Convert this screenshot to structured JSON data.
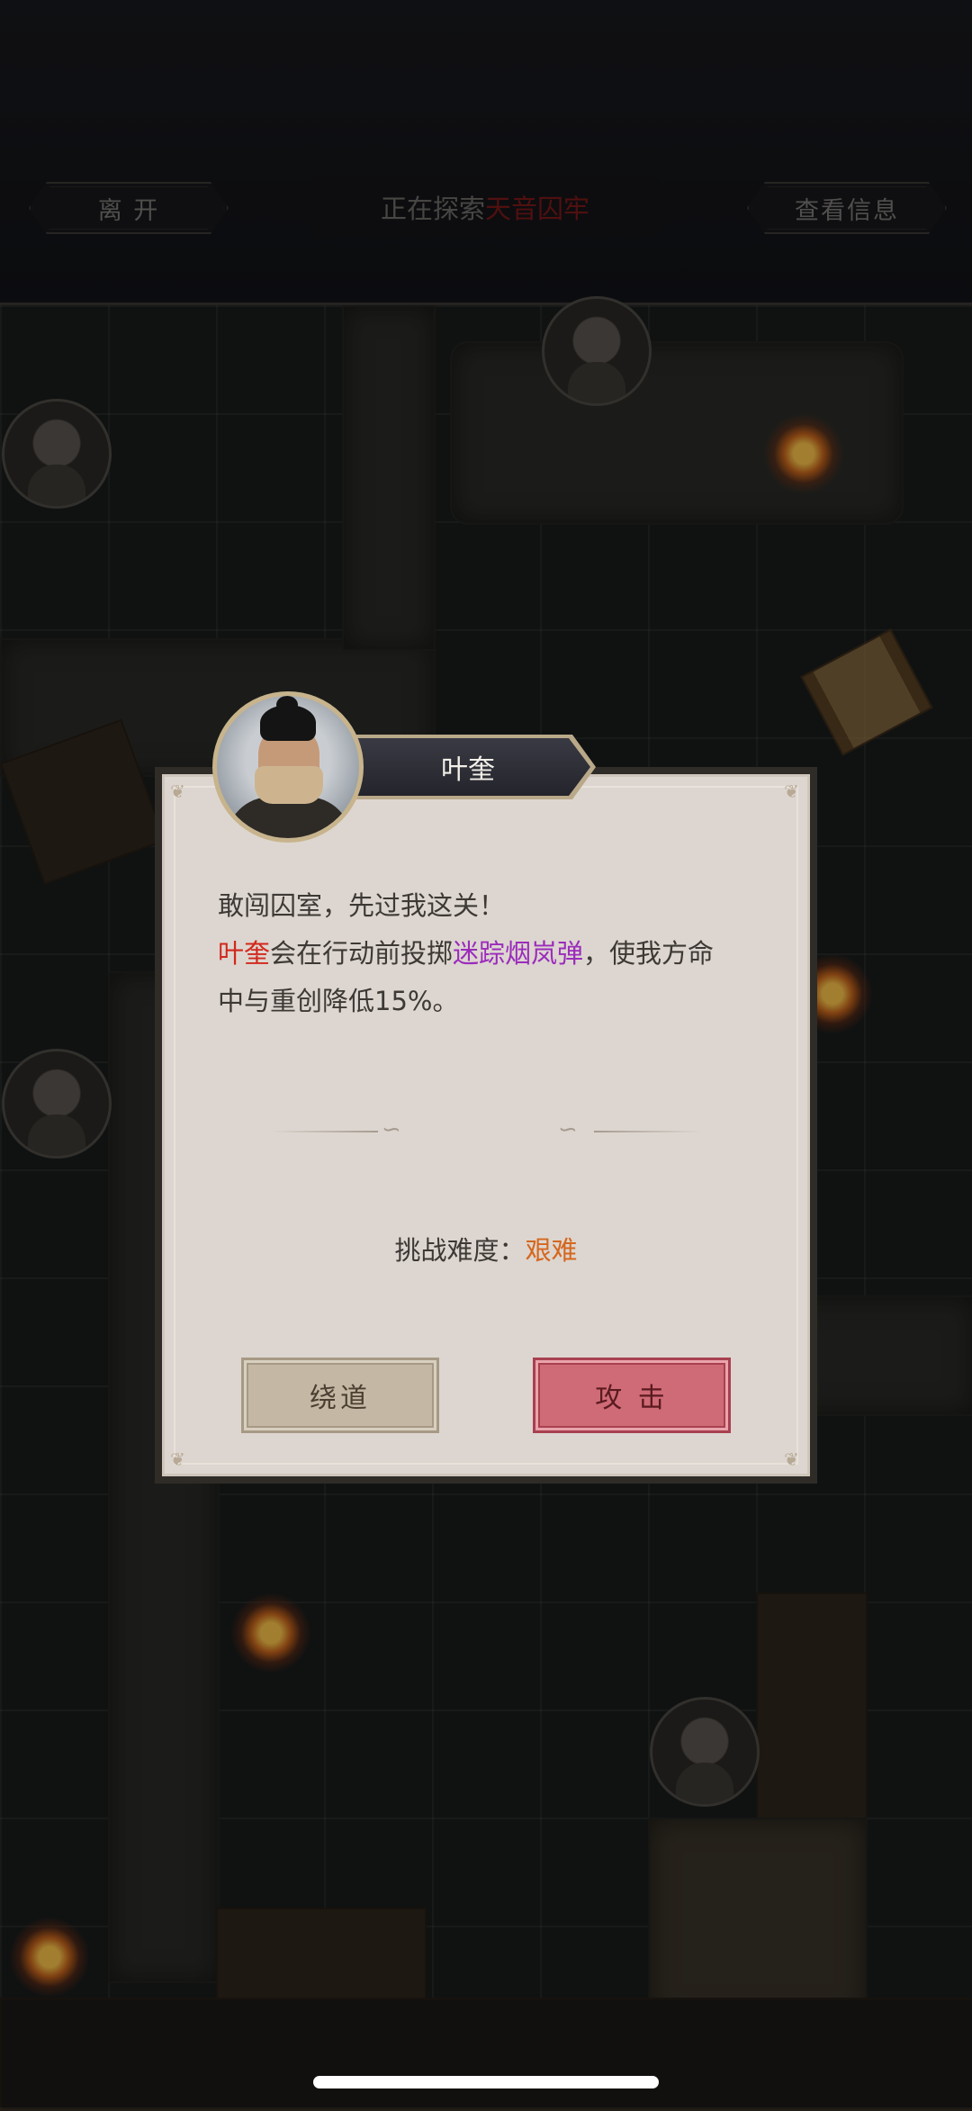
{
  "header": {
    "leave_label": "离 开",
    "exploring_prefix": "正在探索",
    "location_name": "天音囚牢",
    "info_label": "查看信息"
  },
  "dialog": {
    "npc_name": "叶奎",
    "line1": "敢闯囚室，先过我这关！",
    "line2_name": "叶奎",
    "line2_mid": "会在行动前投掷",
    "line2_item": "迷踪烟岚弹",
    "line2_end": "，使我方命",
    "line3": "中与重创降低15%。",
    "difficulty_label": "挑战难度：",
    "difficulty_value": "艰难",
    "detour_label": "绕道",
    "attack_label": "攻 击"
  },
  "colors": {
    "accent_red": "#d2281c",
    "item_purple": "#9b2cbc",
    "difficulty_orange": "#d5671e",
    "attack_button": "#cf6b76",
    "detour_button": "#c4b8a4"
  }
}
